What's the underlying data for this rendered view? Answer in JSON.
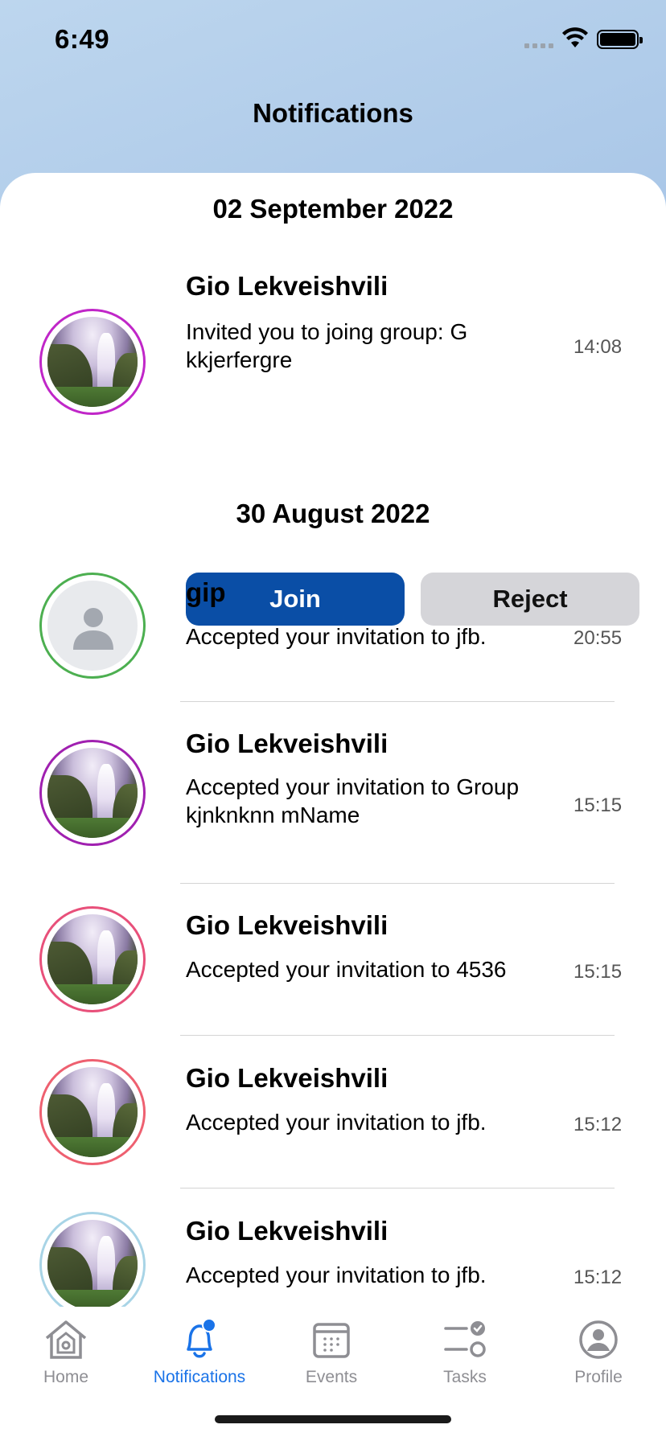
{
  "status_bar": {
    "time": "6:49"
  },
  "header": {
    "title": "Notifications"
  },
  "sections": [
    {
      "date": "02 September 2022",
      "items": [
        {
          "name": "Gio Lekveishvili",
          "text": "Invited you to joing group: G kkjerfergre",
          "time": "14:08",
          "ring_color": "#c42bd0",
          "actions": {
            "join_label": "Join",
            "reject_label": "Reject"
          }
        }
      ]
    },
    {
      "date": "30 August 2022",
      "items": [
        {
          "name": "gip",
          "text": "Accepted your invitation to jfb.",
          "time": "20:55",
          "ring_color": "#4caf50",
          "avatar": "placeholder"
        },
        {
          "name": "Gio Lekveishvili",
          "text": "Accepted your invitation to Group kjnknknn mName",
          "time": "15:15",
          "ring_color": "#a020b0"
        },
        {
          "name": "Gio Lekveishvili",
          "text": "Accepted your invitation to 4536",
          "time": "15:15",
          "ring_color": "#e8507a"
        },
        {
          "name": "Gio Lekveishvili",
          "text": "Accepted your invitation to jfb.",
          "time": "15:12",
          "ring_color": "#ee6070"
        },
        {
          "name": "Gio Lekveishvili",
          "text": "Accepted your invitation to jfb.",
          "time": "15:12",
          "ring_color": "#a8d4e6"
        }
      ]
    }
  ],
  "tab_bar": {
    "tabs": [
      {
        "label": "Home",
        "icon": "home-icon"
      },
      {
        "label": "Notifications",
        "icon": "bell-icon",
        "active": true
      },
      {
        "label": "Events",
        "icon": "calendar-icon"
      },
      {
        "label": "Tasks",
        "icon": "tasks-icon"
      },
      {
        "label": "Profile",
        "icon": "profile-icon"
      }
    ]
  },
  "colors": {
    "accent": "#1a73e8",
    "join_button": "#0a4ea6",
    "reject_button": "#d5d5d9"
  }
}
